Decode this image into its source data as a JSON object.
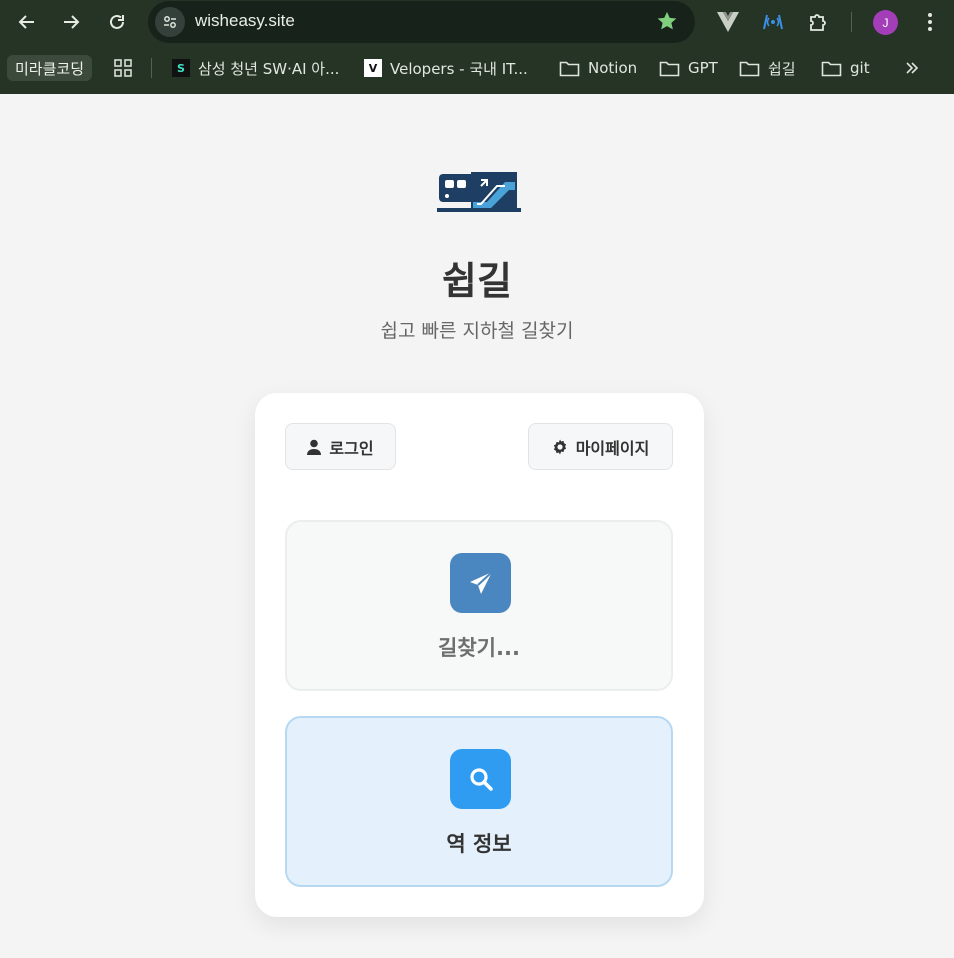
{
  "browser": {
    "url": "wisheasy.site",
    "profile_initial": "J",
    "bookmarks": {
      "pill": "미라클코딩",
      "items": [
        {
          "label": "삼성 청년 SW·AI 아...",
          "icon": "samsung-favicon"
        },
        {
          "label": "Velopers - 국내 IT...",
          "icon": "velopers-favicon"
        },
        {
          "label": "Notion",
          "icon": "folder-icon"
        },
        {
          "label": "GPT",
          "icon": "folder-icon"
        },
        {
          "label": "쉽길",
          "icon": "folder-icon"
        },
        {
          "label": "git",
          "icon": "folder-icon"
        }
      ]
    }
  },
  "page": {
    "title": "쉽길",
    "subtitle": "쉽고 빠른 지하철 길찾기",
    "login_label": "로그인",
    "mypage_label": "마이페이지",
    "find_route_label": "길찾기...",
    "station_info_label": "역 정보"
  },
  "colors": {
    "chrome_bg": "#253424",
    "page_bg": "#f4f4f4",
    "find_icon_bg": "#4a86bf",
    "station_icon_bg": "#2f9cf2",
    "station_card_bg": "#e4f1fc",
    "logo_navy": "#1e3f63"
  }
}
